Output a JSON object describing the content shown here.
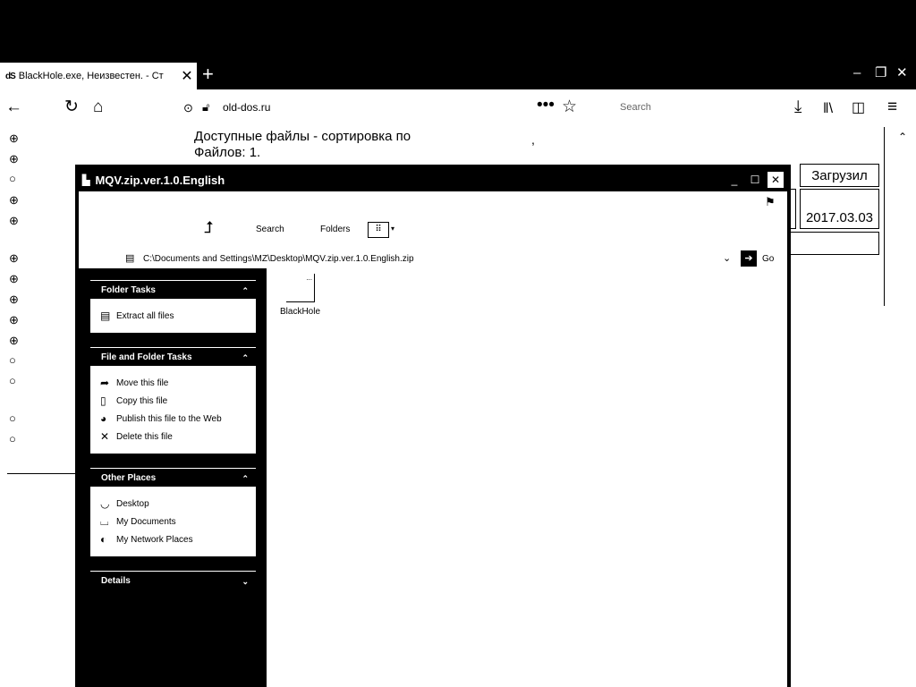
{
  "browser": {
    "tab_title": "BlackHole.exe, Неизвестен. - Ст",
    "url": "old-dos.ru",
    "search_placeholder": "Search"
  },
  "webpage": {
    "heading_line1": "Доступные файлы - сортировка по",
    "heading_line2": "Файлов: 1.",
    "comma": ",",
    "header_col_uploaded": "Загрузил",
    "row_date": "2017.03.03"
  },
  "explorer": {
    "title": "MQV.zip.ver.1.0.English",
    "toolbar": {
      "search": "Search",
      "folders": "Folders"
    },
    "address": "C:\\Documents and Settings\\MZ\\Desktop\\MQV.zip.ver.1.0.English.zip",
    "go": "Go",
    "file_name": "BlackHole",
    "panels": {
      "folder_tasks": {
        "title": "Folder Tasks",
        "items": [
          "Extract all files"
        ]
      },
      "file_folder_tasks": {
        "title": "File and Folder Tasks",
        "items": [
          "Move this file",
          "Copy this file",
          "Publish this file to the Web",
          "Delete this file"
        ]
      },
      "other_places": {
        "title": "Other Places",
        "items": [
          "Desktop",
          "My Documents",
          "My Network Places"
        ]
      },
      "details": {
        "title": "Details"
      }
    }
  }
}
